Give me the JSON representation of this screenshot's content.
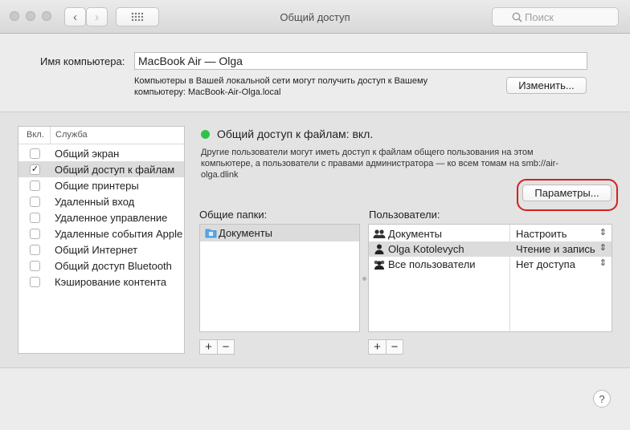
{
  "window": {
    "title": "Общий доступ"
  },
  "toolbar": {
    "back": "‹",
    "forward": "›",
    "grid": "⋯",
    "search_placeholder": "Поиск"
  },
  "computer": {
    "label": "Имя компьютера:",
    "name": "MacBook Air — Olga",
    "hint_line1": "Компьютеры в Вашей локальной сети могут получить доступ к Вашему",
    "hint_line2": "компьютеру: MacBook-Air-Olga.local",
    "edit_button": "Изменить..."
  },
  "services": {
    "col_on": "Вкл.",
    "col_service": "Служба",
    "items": [
      {
        "label": "Общий экран",
        "checked": false
      },
      {
        "label": "Общий доступ к файлам",
        "checked": true
      },
      {
        "label": "Общие принтеры",
        "checked": false
      },
      {
        "label": "Удаленный вход",
        "checked": false
      },
      {
        "label": "Удаленное управление",
        "checked": false
      },
      {
        "label": "Удаленные события Apple",
        "checked": false
      },
      {
        "label": "Общий Интернет",
        "checked": false
      },
      {
        "label": "Общий доступ Bluetooth",
        "checked": false
      },
      {
        "label": "Кэширование контента",
        "checked": false
      }
    ]
  },
  "detail": {
    "status": "Общий доступ к файлам: вкл.",
    "status_color": "#2fc24a",
    "desc_line1": "Другие пользователи могут иметь доступ к файлам общего пользования на этом",
    "desc_line2": "компьютере, а пользователи с правами администратора — ко всем томам на smb://air-",
    "desc_line3": "olga.dlink",
    "params_button": "Параметры...",
    "folders_label": "Общие папки:",
    "folders": [
      "Документы"
    ],
    "users_label": "Пользователи:",
    "users": [
      {
        "name": "Документы",
        "perm": "Настроить",
        "icon": "group-icon"
      },
      {
        "name": "Olga Kotolevych",
        "perm": "Чтение и запись",
        "icon": "user-icon"
      },
      {
        "name": "Все пользователи",
        "perm": "Нет доступа",
        "icon": "everyone-icon"
      }
    ],
    "add": "+",
    "remove": "−"
  },
  "help": "?"
}
